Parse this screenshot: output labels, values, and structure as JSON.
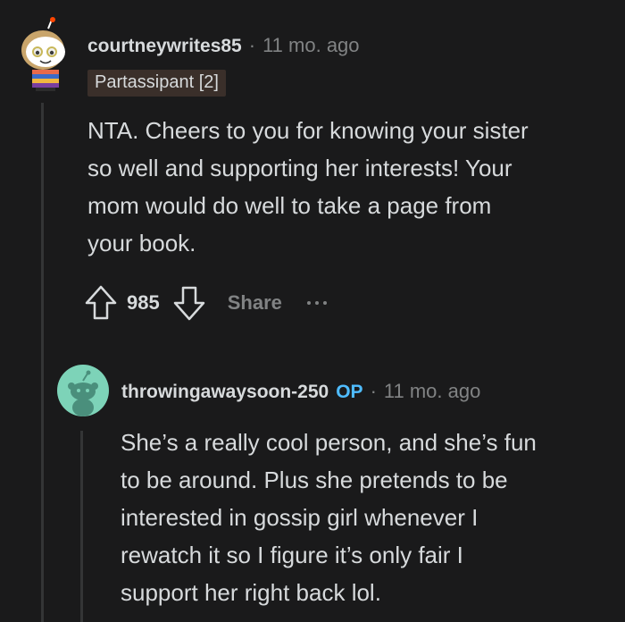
{
  "comments": [
    {
      "username": "courtneywrites85",
      "separator": "·",
      "timestamp": "11 mo. ago",
      "flair": "Partassipant [2]",
      "body_lines": [
        "NTA. Cheers to you for knowing your sister",
        "so well and supporting her interests! Your",
        "mom would do well to take a page from",
        "your book."
      ],
      "score": "985",
      "share_label": "Share",
      "upvote_icon": "upvote-arrow-icon",
      "downvote_icon": "downvote-arrow-icon",
      "more_icon": "more-options-icon",
      "avatar_icon": "snoo-avatar-icon"
    },
    {
      "username": "throwingawaysoon-250",
      "op_label": "OP",
      "separator": "·",
      "timestamp": "11 mo. ago",
      "body_lines": [
        "She’s a really cool person, and she’s fun",
        "to be around. Plus she pretends to be",
        "interested in gossip girl whenever I",
        "rewatch it so I figure it’s only fair I",
        "support her right back lol."
      ],
      "avatar_icon": "default-snoo-avatar-icon"
    }
  ],
  "colors": {
    "background": "#1a1a1b",
    "text": "#d7dadc",
    "muted": "#818384",
    "op_blue": "#4fbcff",
    "flair_bg": "#3a2f2a",
    "avatar_teal": "#7dd3b8"
  }
}
